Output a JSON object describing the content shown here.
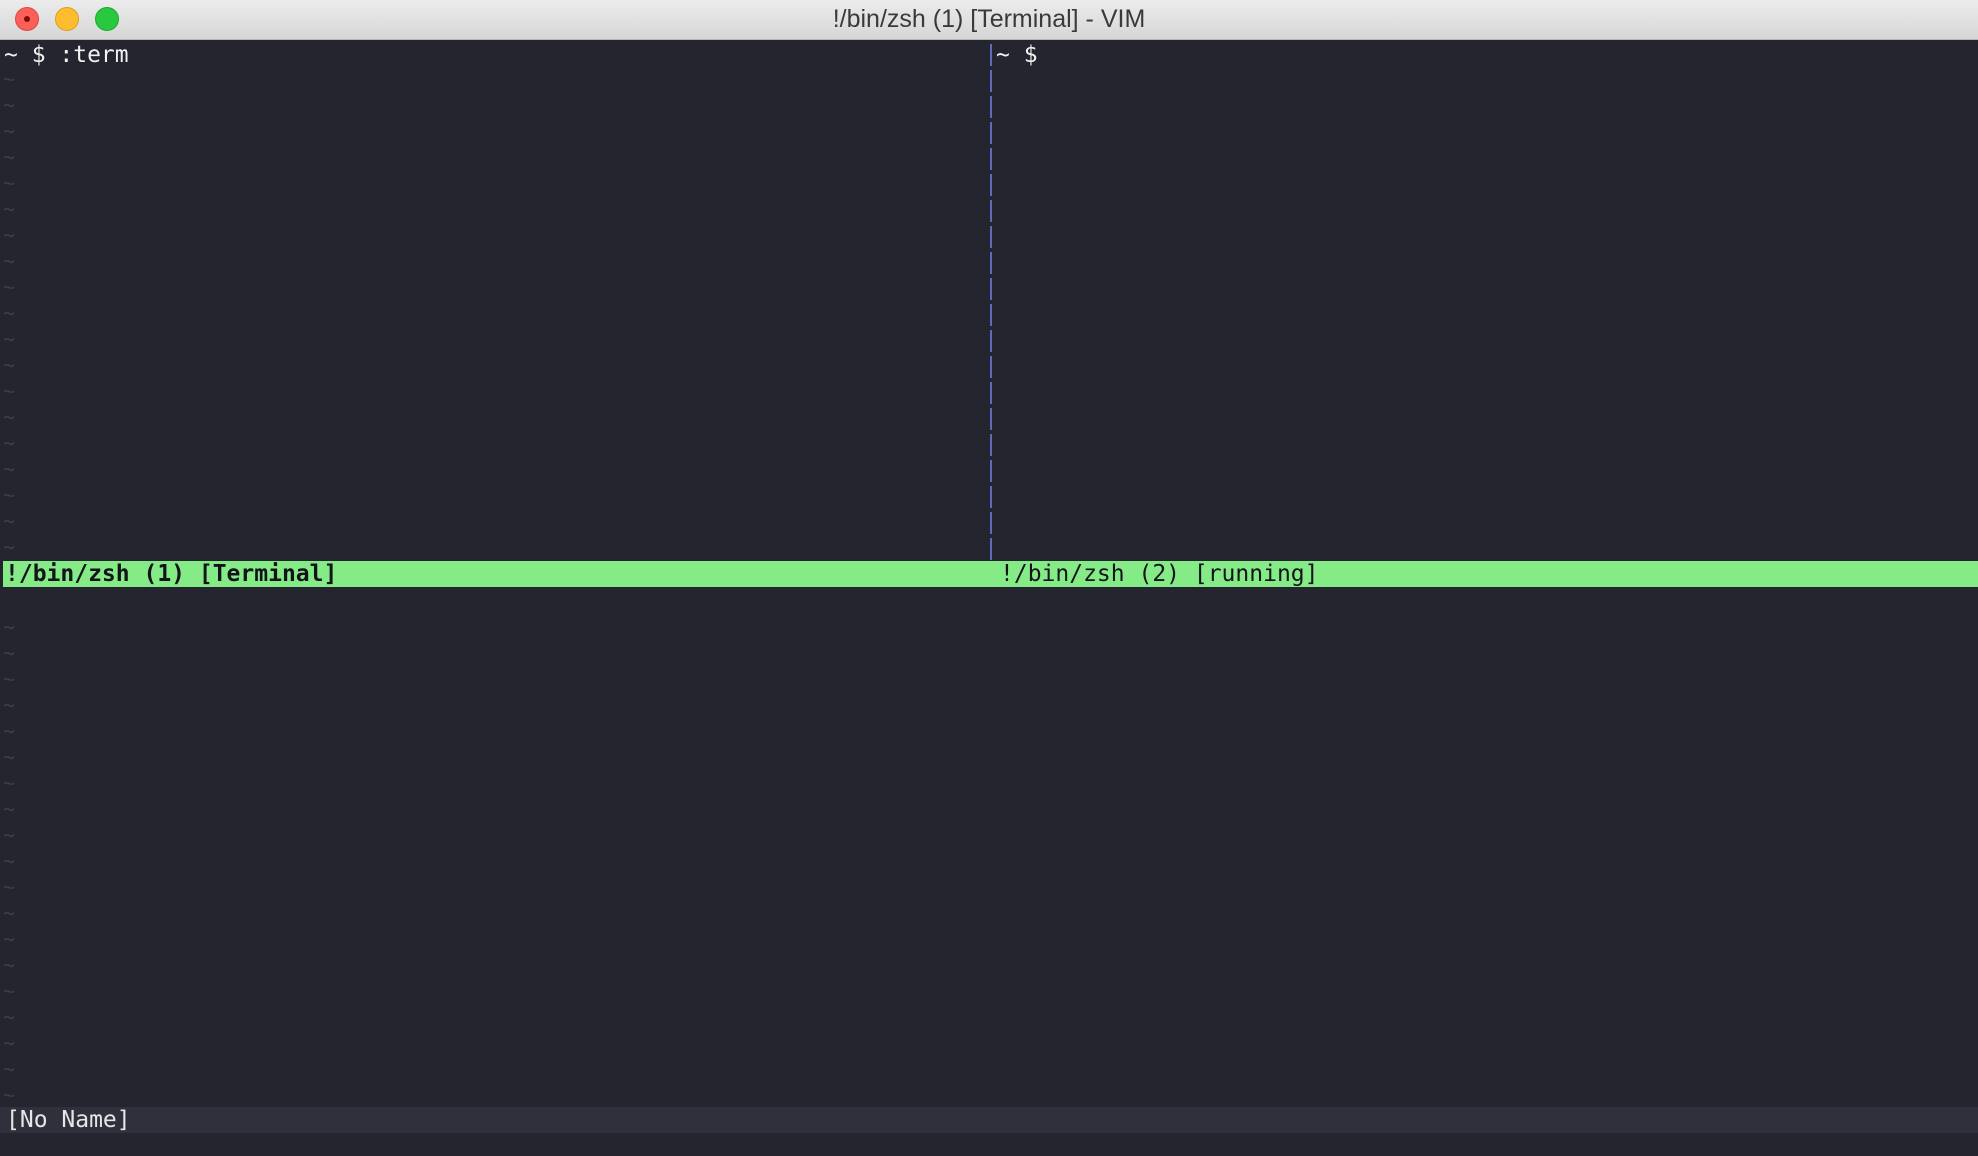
{
  "window": {
    "title": "!/bin/zsh (1) [Terminal] - VIM"
  },
  "panes": {
    "left": {
      "prompt_line": "~ $ :term"
    },
    "right": {
      "prompt_line": "~ $"
    }
  },
  "statuslines": {
    "top_left": "!/bin/zsh (1) [Terminal]",
    "top_right": "!/bin/zsh (2) [running]",
    "bottom": "[No Name]"
  },
  "filler": {
    "tilde": "~",
    "top_count": 19,
    "bottom_count": 19
  },
  "colors": {
    "background": "#24252f",
    "active_status": "#85eb87",
    "inactive_status": "#2f303c",
    "split_divider": "#5f6bb8",
    "tilde": "#3d3f4d"
  }
}
